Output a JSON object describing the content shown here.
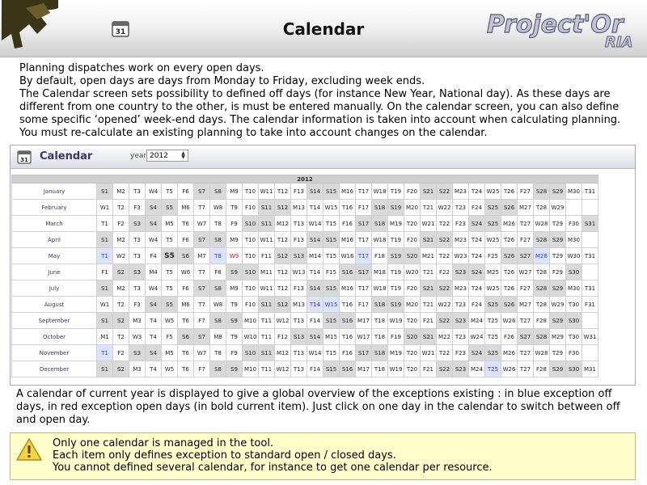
{
  "header": {
    "title": "Calendar",
    "brand": "Project'Or",
    "brand_suffix": "RIA",
    "calendar_icon_text": "31"
  },
  "intro": [
    "Planning dispatches work on every open days.",
    "By default, open days are days from Monday to Friday, excluding week ends.",
    "The Calendar screen sets possibility to defined off days (for instance New Year, National day). As these days are different from one country to the other, is must be entered manually. On the calendar screen, you can also define some specific ‘opened’ week-end days. The calendar information is taken into account when calculating planning. You must re-calculate an existing planning to take into account changes on the calendar."
  ],
  "calendar": {
    "title": "Calendar",
    "icon_text": "31",
    "year_label": "year",
    "year_value": "2012",
    "year_header": "2012",
    "weekday_letters": [
      "M",
      "T",
      "W",
      "T",
      "F",
      "S",
      "S"
    ],
    "months": [
      {
        "name": "January",
        "first_weekday": 6,
        "days": 31
      },
      {
        "name": "February",
        "first_weekday": 2,
        "days": 29
      },
      {
        "name": "March",
        "first_weekday": 3,
        "days": 31
      },
      {
        "name": "April",
        "first_weekday": 6,
        "days": 30
      },
      {
        "name": "May",
        "first_weekday": 1,
        "days": 31
      },
      {
        "name": "June",
        "first_weekday": 4,
        "days": 30
      },
      {
        "name": "July",
        "first_weekday": 6,
        "days": 31
      },
      {
        "name": "August",
        "first_weekday": 2,
        "days": 31
      },
      {
        "name": "September",
        "first_weekday": 5,
        "days": 30
      },
      {
        "name": "October",
        "first_weekday": 0,
        "days": 31
      },
      {
        "name": "November",
        "first_weekday": 3,
        "days": 30
      },
      {
        "name": "December",
        "first_weekday": 5,
        "days": 31
      }
    ],
    "off_days": [
      {
        "month": 5,
        "day": 1
      },
      {
        "month": 5,
        "day": 8
      },
      {
        "month": 5,
        "day": 17
      },
      {
        "month": 5,
        "day": 28
      },
      {
        "month": 8,
        "day": 14
      },
      {
        "month": 8,
        "day": 15
      },
      {
        "month": 11,
        "day": 1
      },
      {
        "month": 12,
        "day": 25
      }
    ],
    "open_weekend_days": [
      {
        "month": 5,
        "day": 9
      }
    ],
    "current_day": {
      "month": 5,
      "day": 5
    },
    "colors": {
      "off_day_bg": "#dde3ff",
      "off_day_text": "#2e3fd0",
      "open_day_text": "#d01010",
      "weekend_bg": "#d9d9d9"
    }
  },
  "outro": [
    "A calendar of current year is displayed to give a global overview of the exceptions existing : in blue exception off days, in red exception open days (in bold current item). Just click on one day in the calendar to switch between off and open day."
  ],
  "note": {
    "icon": "warning-icon",
    "lines": [
      "Only one calendar is managed in the tool.",
      "Each item only defines exception to standard open / closed days.",
      "You cannot defined several calendar, for instance to get one calendar per resource."
    ]
  }
}
